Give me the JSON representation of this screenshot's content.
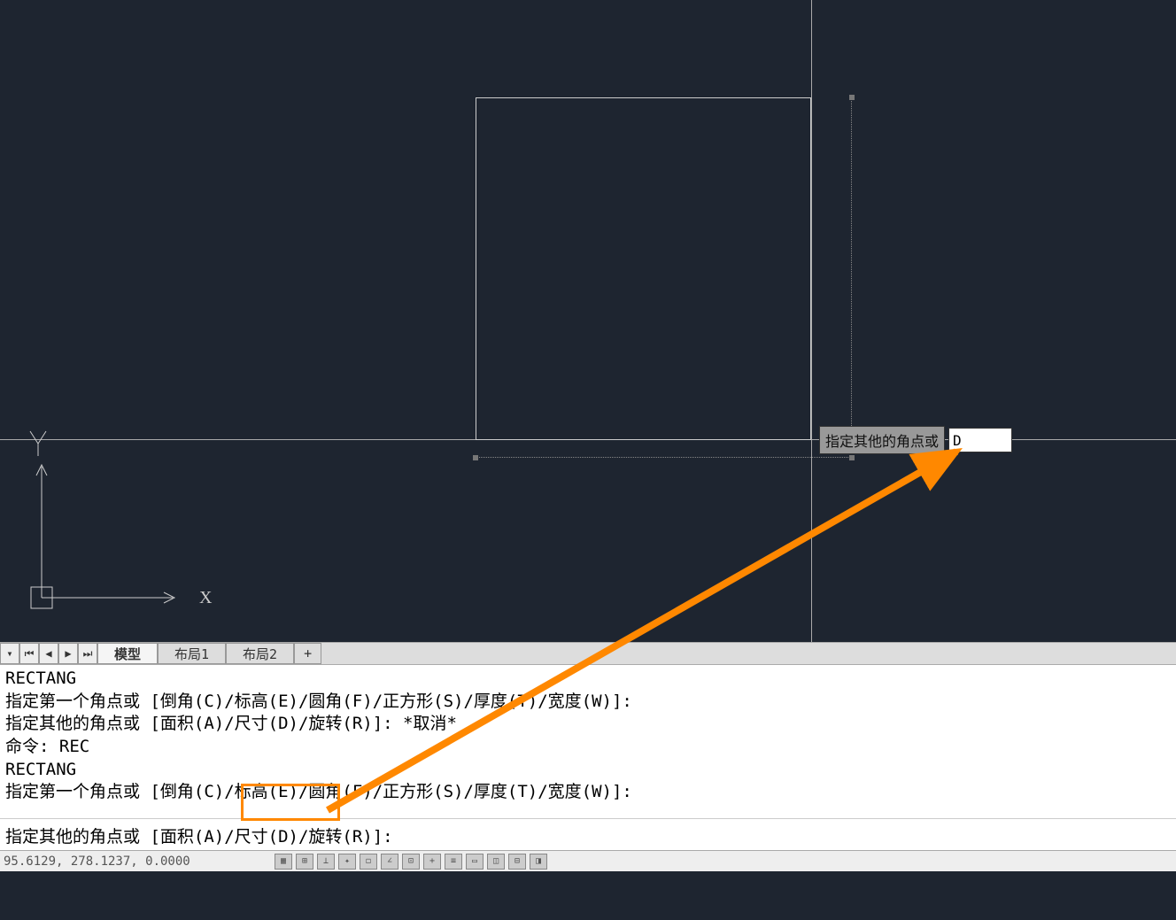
{
  "canvas": {
    "prompt_label": "指定其他的角点或",
    "prompt_value": "D",
    "ucs_x": "X",
    "ucs_y": "Y"
  },
  "tabs": {
    "model": "模型",
    "layout1": "布局1",
    "layout2": "布局2",
    "plus": "+"
  },
  "command_history": {
    "line1": "RECTANG",
    "line2": "指定第一个角点或 [倒角(C)/标高(E)/圆角(F)/正方形(S)/厚度(T)/宽度(W)]:",
    "line3": "指定其他的角点或 [面积(A)/尺寸(D)/旋转(R)]: *取消*",
    "line4": "命令: REC",
    "line5": "RECTANG",
    "line6": "指定第一个角点或 [倒角(C)/标高(E)/圆角(F)/正方形(S)/厚度(T)/宽度(W)]:"
  },
  "command_line": {
    "text": "指定其他的角点或 [面积(A)/尺寸(D)/旋转(R)]:"
  },
  "status": {
    "coords": "95.6129, 278.1237, 0.0000"
  },
  "nav": {
    "first": "⏮",
    "prev": "◀",
    "next": "▶",
    "last": "⏭"
  }
}
